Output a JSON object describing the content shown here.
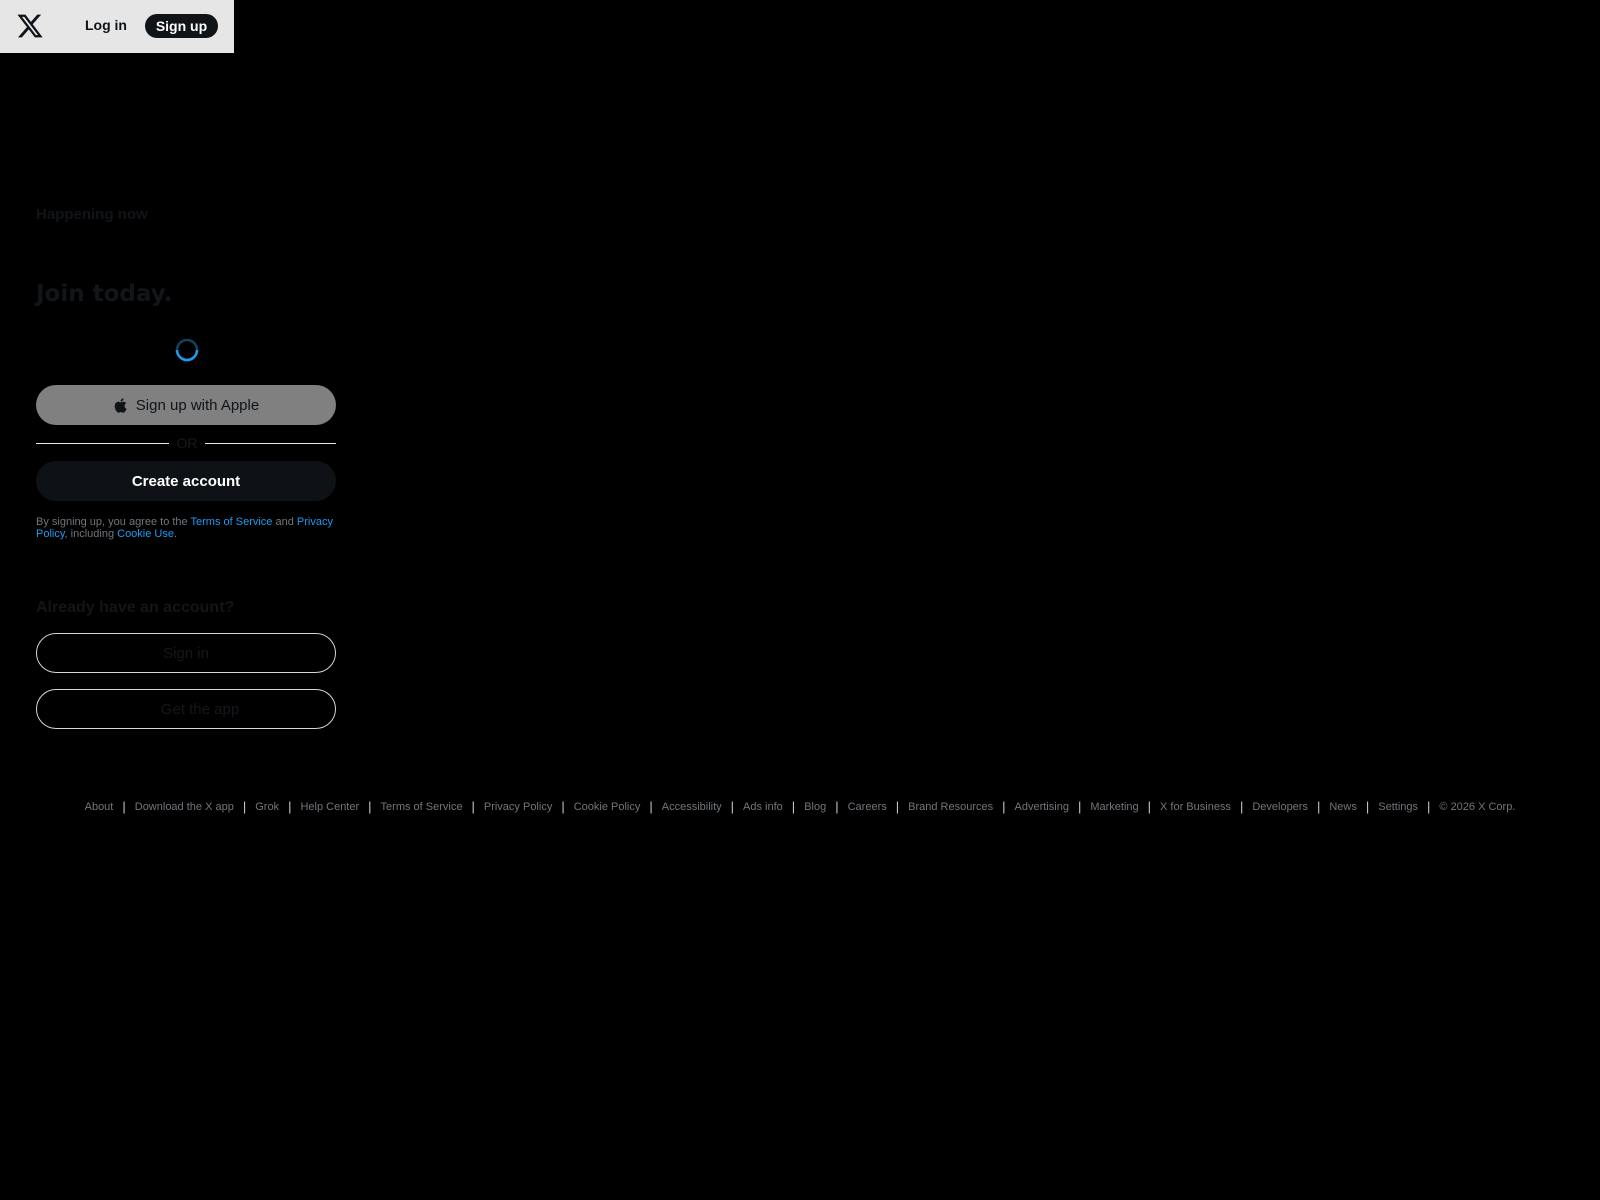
{
  "topbar": {
    "logo": "x-logo-icon",
    "login_label": "Log in",
    "signup_label": "Sign up"
  },
  "main": {
    "happening": "Happening now",
    "join": "Join today.",
    "apple_button": "Sign up with Apple",
    "or": "OR",
    "create_account": "Create account",
    "terms": {
      "prefix": "By signing up, you agree to the ",
      "tos": "Terms of Service",
      "and": " and ",
      "privacy": "Privacy Policy",
      "including": ", including ",
      "cookie": "Cookie Use",
      "suffix": "."
    },
    "already": "Already have an account?",
    "sign_in": "Sign in",
    "get_app": "Get the app"
  },
  "footer": {
    "items": [
      "About",
      "Download the X app",
      "Grok",
      "Help Center",
      "Terms of Service",
      "Privacy Policy",
      "Cookie Policy",
      "Accessibility",
      "Ads info",
      "Blog",
      "Careers",
      "Brand Resources",
      "Advertising",
      "Marketing",
      "X for Business",
      "Developers",
      "News",
      "Settings"
    ],
    "copyright": "© 2026 X Corp."
  },
  "colors": {
    "accent": "#1d9bf0",
    "background": "#000000",
    "topbar": "#e6e6e6"
  }
}
